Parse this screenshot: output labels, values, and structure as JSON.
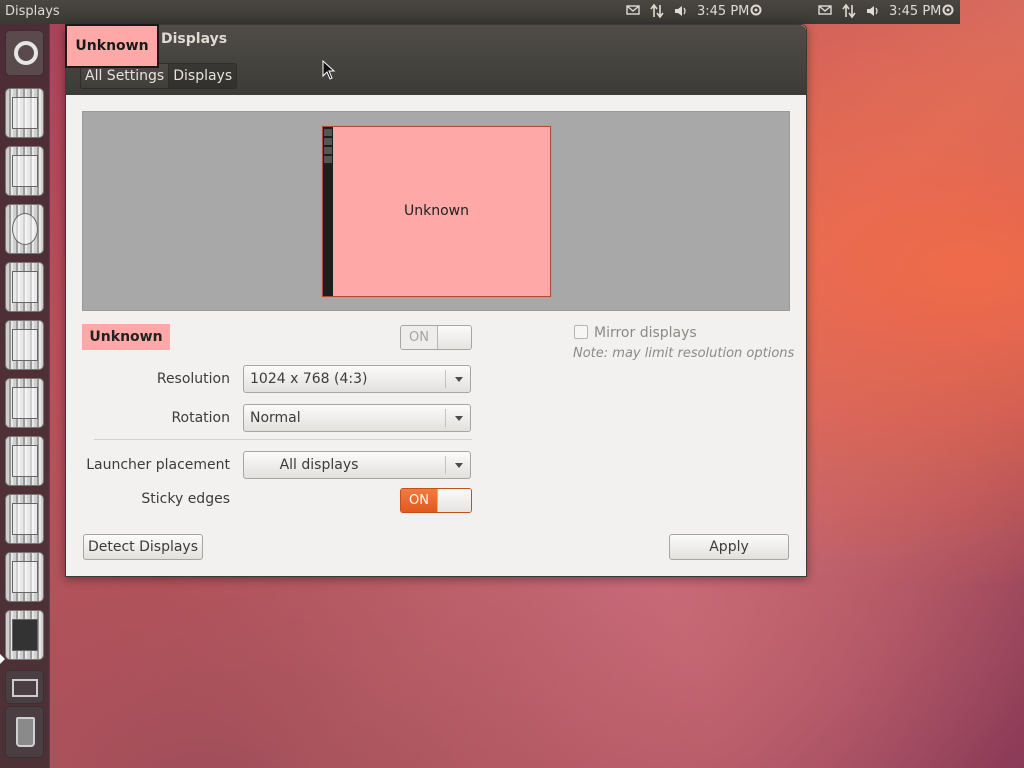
{
  "top_panel": {
    "app_title": "Displays",
    "indicators": [
      {
        "icon": "mail-icon"
      },
      {
        "icon": "network-icon"
      },
      {
        "icon": "volume-icon"
      },
      {
        "clock": "3:45 PM"
      },
      {
        "icon": "session-gear-icon"
      },
      {
        "icon": "mail-icon"
      },
      {
        "icon": "network-icon"
      },
      {
        "icon": "volume-icon"
      },
      {
        "clock": "3:45 PM"
      },
      {
        "icon": "session-gear-icon"
      }
    ]
  },
  "launcher": {
    "items": [
      {
        "icon": "dash-home-icon"
      },
      {
        "icon": "files-icon"
      },
      {
        "icon": "folder-icon"
      },
      {
        "icon": "music-icon"
      },
      {
        "icon": "writer-icon"
      },
      {
        "icon": "calc-icon"
      },
      {
        "icon": "impress-icon"
      },
      {
        "icon": "software-center-icon"
      },
      {
        "icon": "ubuntu-one-icon"
      },
      {
        "icon": "system-settings-icon"
      },
      {
        "icon": "displays-icon"
      },
      {
        "icon": "workspace-switcher-icon"
      },
      {
        "icon": "trash-icon"
      }
    ]
  },
  "window": {
    "title": "Displays",
    "overlay_label": "Unknown",
    "breadcrumbs": [
      "All Settings",
      "Displays"
    ]
  },
  "arrangement": {
    "monitor_label": "Unknown",
    "monitor_color": "#ffa8a8"
  },
  "display": {
    "name": "Unknown",
    "power_switch": {
      "label": "ON",
      "state": "on",
      "enabled": false
    },
    "mirror": {
      "label": "Mirror displays",
      "checked": false,
      "enabled": false
    },
    "note": "Note: may limit resolution options",
    "resolution": {
      "label": "Resolution",
      "value": "1024 x 768 (4:3)"
    },
    "rotation": {
      "label": "Rotation",
      "value": "Normal"
    }
  },
  "launcher_settings": {
    "placement": {
      "label": "Launcher placement",
      "value": "All displays"
    },
    "sticky_edges": {
      "label": "Sticky edges",
      "switch_label": "ON",
      "state": "on"
    }
  },
  "buttons": {
    "detect": "Detect Displays",
    "apply": "Apply"
  },
  "colors": {
    "accent": "#e05a20",
    "monitor_pink": "#ffa8a8"
  }
}
